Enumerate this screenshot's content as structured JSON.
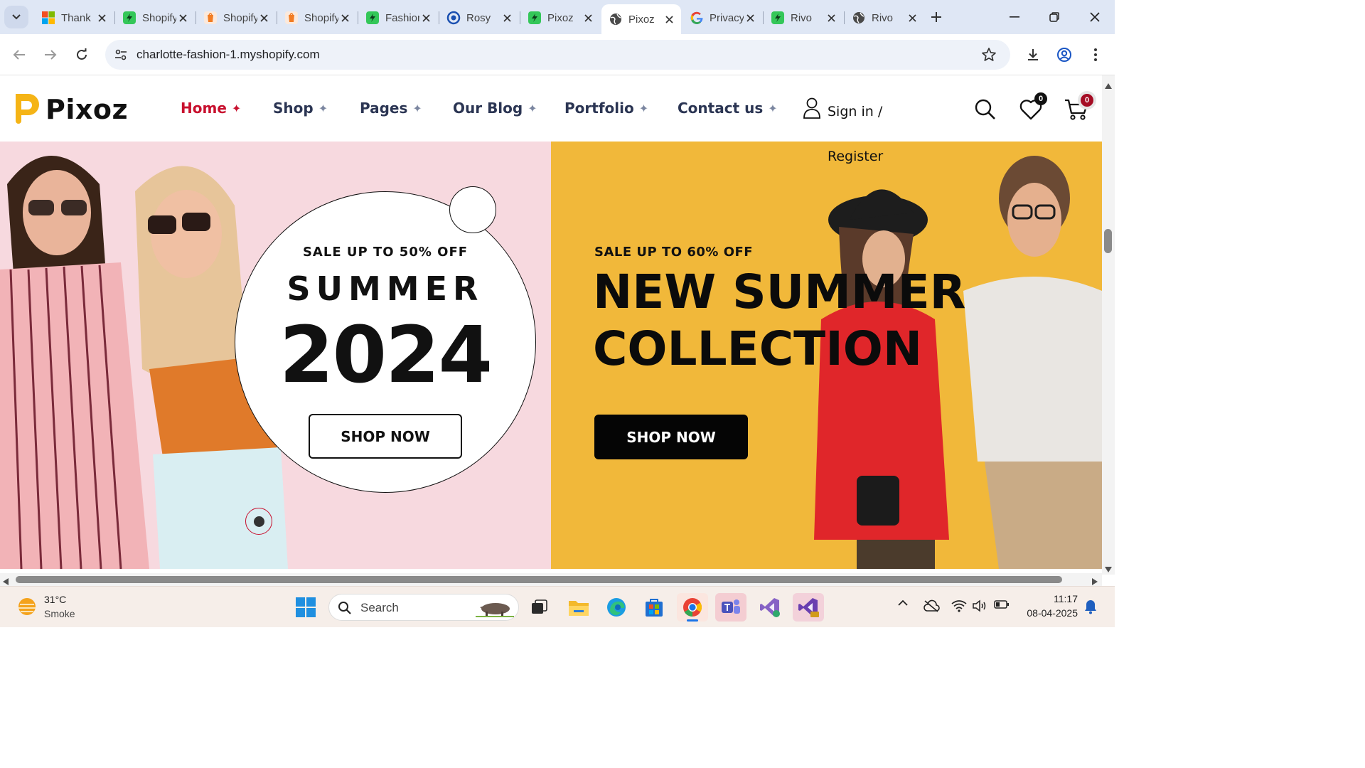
{
  "browser": {
    "tabs": [
      {
        "title": "Thank",
        "favicon": "microsoft-icon"
      },
      {
        "title": "Shopify",
        "favicon": "shopify-green-icon"
      },
      {
        "title": "Shopify",
        "favicon": "shopify-orange-icon"
      },
      {
        "title": "Shopify",
        "favicon": "shopify-orange-icon"
      },
      {
        "title": "Fashion",
        "favicon": "shopify-green-icon"
      },
      {
        "title": "Rosy",
        "favicon": "rosy-icon"
      },
      {
        "title": "Pixoz",
        "favicon": "shopify-green-icon"
      },
      {
        "title": "Pixoz",
        "favicon": "globe-icon"
      },
      {
        "title": "Privacy",
        "favicon": "google-icon"
      },
      {
        "title": "Rivo",
        "favicon": "shopify-green-icon"
      },
      {
        "title": "Rivo",
        "favicon": "globe-icon"
      }
    ],
    "active_tab_index": 7,
    "url": "charlotte-fashion-1.myshopify.com"
  },
  "site": {
    "logo_text": "Pixoz",
    "brand_color": "#f5b416",
    "accent_color": "#c8102e",
    "menu": [
      {
        "label": "Home",
        "active": true
      },
      {
        "label": "Shop",
        "active": false
      },
      {
        "label": "Pages",
        "active": false
      },
      {
        "label": "Our Blog",
        "active": false
      },
      {
        "label": "Portfolio",
        "active": false
      },
      {
        "label": "Contact us",
        "active": false
      }
    ],
    "menu_plus_glyph": "✦",
    "sign_in": "Sign in /",
    "register": "Register",
    "wishlist_count": "0",
    "cart_count": "0"
  },
  "hero": {
    "left": {
      "sale_text": "SALE UP TO 50% OFF",
      "headline": "SUMMER",
      "year": "2024",
      "button": "SHOP NOW",
      "background": "#f7d9df"
    },
    "right": {
      "sale_text": "SALE UP TO 60% OFF",
      "headline_line1": "NEW SUMMER",
      "headline_line2": "COLLECTION",
      "button": "SHOP NOW",
      "background": "#f1b83a"
    }
  },
  "taskbar": {
    "weather_temp": "31°C",
    "weather_desc": "Smoke",
    "search_placeholder": "Search",
    "time": "11:17",
    "date": "08-04-2025"
  }
}
